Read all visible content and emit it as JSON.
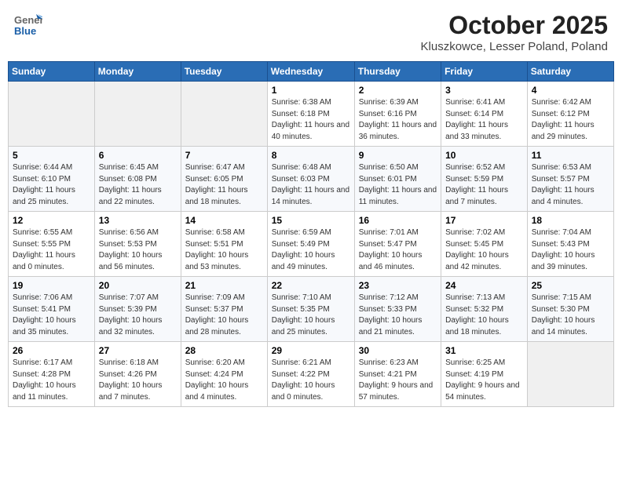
{
  "header": {
    "logo_general": "General",
    "logo_blue": "Blue",
    "month": "October 2025",
    "location": "Kluszkowce, Lesser Poland, Poland"
  },
  "days_of_week": [
    "Sunday",
    "Monday",
    "Tuesday",
    "Wednesday",
    "Thursday",
    "Friday",
    "Saturday"
  ],
  "weeks": [
    [
      {
        "day": "",
        "sunrise": "",
        "sunset": "",
        "daylight": "",
        "empty": true
      },
      {
        "day": "",
        "sunrise": "",
        "sunset": "",
        "daylight": "",
        "empty": true
      },
      {
        "day": "",
        "sunrise": "",
        "sunset": "",
        "daylight": "",
        "empty": true
      },
      {
        "day": "1",
        "sunrise": "Sunrise: 6:38 AM",
        "sunset": "Sunset: 6:18 PM",
        "daylight": "Daylight: 11 hours and 40 minutes.",
        "empty": false
      },
      {
        "day": "2",
        "sunrise": "Sunrise: 6:39 AM",
        "sunset": "Sunset: 6:16 PM",
        "daylight": "Daylight: 11 hours and 36 minutes.",
        "empty": false
      },
      {
        "day": "3",
        "sunrise": "Sunrise: 6:41 AM",
        "sunset": "Sunset: 6:14 PM",
        "daylight": "Daylight: 11 hours and 33 minutes.",
        "empty": false
      },
      {
        "day": "4",
        "sunrise": "Sunrise: 6:42 AM",
        "sunset": "Sunset: 6:12 PM",
        "daylight": "Daylight: 11 hours and 29 minutes.",
        "empty": false
      }
    ],
    [
      {
        "day": "5",
        "sunrise": "Sunrise: 6:44 AM",
        "sunset": "Sunset: 6:10 PM",
        "daylight": "Daylight: 11 hours and 25 minutes.",
        "empty": false
      },
      {
        "day": "6",
        "sunrise": "Sunrise: 6:45 AM",
        "sunset": "Sunset: 6:08 PM",
        "daylight": "Daylight: 11 hours and 22 minutes.",
        "empty": false
      },
      {
        "day": "7",
        "sunrise": "Sunrise: 6:47 AM",
        "sunset": "Sunset: 6:05 PM",
        "daylight": "Daylight: 11 hours and 18 minutes.",
        "empty": false
      },
      {
        "day": "8",
        "sunrise": "Sunrise: 6:48 AM",
        "sunset": "Sunset: 6:03 PM",
        "daylight": "Daylight: 11 hours and 14 minutes.",
        "empty": false
      },
      {
        "day": "9",
        "sunrise": "Sunrise: 6:50 AM",
        "sunset": "Sunset: 6:01 PM",
        "daylight": "Daylight: 11 hours and 11 minutes.",
        "empty": false
      },
      {
        "day": "10",
        "sunrise": "Sunrise: 6:52 AM",
        "sunset": "Sunset: 5:59 PM",
        "daylight": "Daylight: 11 hours and 7 minutes.",
        "empty": false
      },
      {
        "day": "11",
        "sunrise": "Sunrise: 6:53 AM",
        "sunset": "Sunset: 5:57 PM",
        "daylight": "Daylight: 11 hours and 4 minutes.",
        "empty": false
      }
    ],
    [
      {
        "day": "12",
        "sunrise": "Sunrise: 6:55 AM",
        "sunset": "Sunset: 5:55 PM",
        "daylight": "Daylight: 11 hours and 0 minutes.",
        "empty": false
      },
      {
        "day": "13",
        "sunrise": "Sunrise: 6:56 AM",
        "sunset": "Sunset: 5:53 PM",
        "daylight": "Daylight: 10 hours and 56 minutes.",
        "empty": false
      },
      {
        "day": "14",
        "sunrise": "Sunrise: 6:58 AM",
        "sunset": "Sunset: 5:51 PM",
        "daylight": "Daylight: 10 hours and 53 minutes.",
        "empty": false
      },
      {
        "day": "15",
        "sunrise": "Sunrise: 6:59 AM",
        "sunset": "Sunset: 5:49 PM",
        "daylight": "Daylight: 10 hours and 49 minutes.",
        "empty": false
      },
      {
        "day": "16",
        "sunrise": "Sunrise: 7:01 AM",
        "sunset": "Sunset: 5:47 PM",
        "daylight": "Daylight: 10 hours and 46 minutes.",
        "empty": false
      },
      {
        "day": "17",
        "sunrise": "Sunrise: 7:02 AM",
        "sunset": "Sunset: 5:45 PM",
        "daylight": "Daylight: 10 hours and 42 minutes.",
        "empty": false
      },
      {
        "day": "18",
        "sunrise": "Sunrise: 7:04 AM",
        "sunset": "Sunset: 5:43 PM",
        "daylight": "Daylight: 10 hours and 39 minutes.",
        "empty": false
      }
    ],
    [
      {
        "day": "19",
        "sunrise": "Sunrise: 7:06 AM",
        "sunset": "Sunset: 5:41 PM",
        "daylight": "Daylight: 10 hours and 35 minutes.",
        "empty": false
      },
      {
        "day": "20",
        "sunrise": "Sunrise: 7:07 AM",
        "sunset": "Sunset: 5:39 PM",
        "daylight": "Daylight: 10 hours and 32 minutes.",
        "empty": false
      },
      {
        "day": "21",
        "sunrise": "Sunrise: 7:09 AM",
        "sunset": "Sunset: 5:37 PM",
        "daylight": "Daylight: 10 hours and 28 minutes.",
        "empty": false
      },
      {
        "day": "22",
        "sunrise": "Sunrise: 7:10 AM",
        "sunset": "Sunset: 5:35 PM",
        "daylight": "Daylight: 10 hours and 25 minutes.",
        "empty": false
      },
      {
        "day": "23",
        "sunrise": "Sunrise: 7:12 AM",
        "sunset": "Sunset: 5:33 PM",
        "daylight": "Daylight: 10 hours and 21 minutes.",
        "empty": false
      },
      {
        "day": "24",
        "sunrise": "Sunrise: 7:13 AM",
        "sunset": "Sunset: 5:32 PM",
        "daylight": "Daylight: 10 hours and 18 minutes.",
        "empty": false
      },
      {
        "day": "25",
        "sunrise": "Sunrise: 7:15 AM",
        "sunset": "Sunset: 5:30 PM",
        "daylight": "Daylight: 10 hours and 14 minutes.",
        "empty": false
      }
    ],
    [
      {
        "day": "26",
        "sunrise": "Sunrise: 6:17 AM",
        "sunset": "Sunset: 4:28 PM",
        "daylight": "Daylight: 10 hours and 11 minutes.",
        "empty": false
      },
      {
        "day": "27",
        "sunrise": "Sunrise: 6:18 AM",
        "sunset": "Sunset: 4:26 PM",
        "daylight": "Daylight: 10 hours and 7 minutes.",
        "empty": false
      },
      {
        "day": "28",
        "sunrise": "Sunrise: 6:20 AM",
        "sunset": "Sunset: 4:24 PM",
        "daylight": "Daylight: 10 hours and 4 minutes.",
        "empty": false
      },
      {
        "day": "29",
        "sunrise": "Sunrise: 6:21 AM",
        "sunset": "Sunset: 4:22 PM",
        "daylight": "Daylight: 10 hours and 0 minutes.",
        "empty": false
      },
      {
        "day": "30",
        "sunrise": "Sunrise: 6:23 AM",
        "sunset": "Sunset: 4:21 PM",
        "daylight": "Daylight: 9 hours and 57 minutes.",
        "empty": false
      },
      {
        "day": "31",
        "sunrise": "Sunrise: 6:25 AM",
        "sunset": "Sunset: 4:19 PM",
        "daylight": "Daylight: 9 hours and 54 minutes.",
        "empty": false
      },
      {
        "day": "",
        "sunrise": "",
        "sunset": "",
        "daylight": "",
        "empty": true
      }
    ]
  ]
}
